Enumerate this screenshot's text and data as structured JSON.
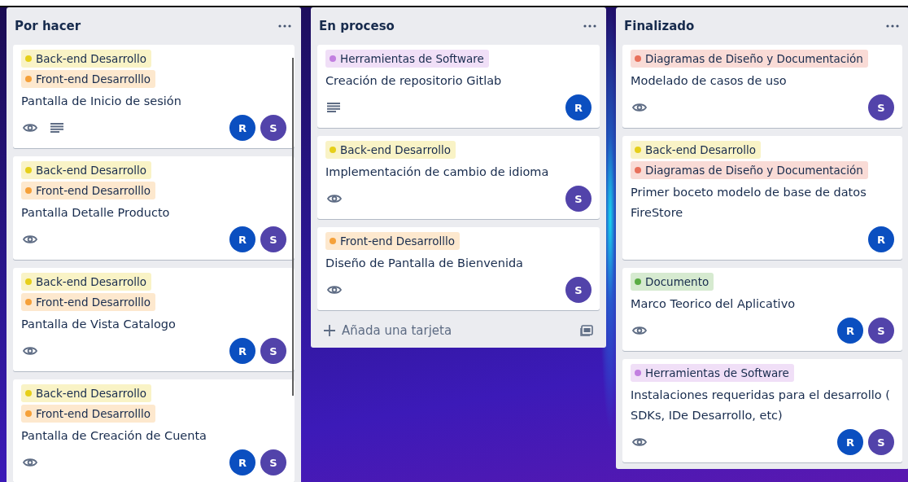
{
  "lists": [
    {
      "title": "Por hacer",
      "scrollbar": true,
      "cards": [
        {
          "labels": [
            {
              "text": "Back-end Desarrollo",
              "color": "#e6cf1a"
            },
            {
              "text": "Front-end Desarrolllo",
              "color": "#f5a13a"
            }
          ],
          "title": "Pantalla de Inicio de sesión",
          "watched": true,
          "has_description": true,
          "members": [
            {
              "initial": "R",
              "color": "#0b4fc0"
            },
            {
              "initial": "S",
              "color": "#5243aa"
            }
          ]
        },
        {
          "labels": [
            {
              "text": "Back-end Desarrollo",
              "color": "#e6cf1a"
            },
            {
              "text": "Front-end Desarrolllo",
              "color": "#f5a13a"
            }
          ],
          "title": "Pantalla Detalle Producto",
          "watched": true,
          "has_description": false,
          "members": [
            {
              "initial": "R",
              "color": "#0b4fc0"
            },
            {
              "initial": "S",
              "color": "#5243aa"
            }
          ]
        },
        {
          "labels": [
            {
              "text": "Back-end Desarrollo",
              "color": "#e6cf1a"
            },
            {
              "text": "Front-end Desarrolllo",
              "color": "#f5a13a"
            }
          ],
          "title": "Pantalla de Vista Catalogo",
          "watched": true,
          "has_description": false,
          "members": [
            {
              "initial": "R",
              "color": "#0b4fc0"
            },
            {
              "initial": "S",
              "color": "#5243aa"
            }
          ]
        },
        {
          "labels": [
            {
              "text": "Back-end Desarrollo",
              "color": "#e6cf1a"
            },
            {
              "text": "Front-end Desarrolllo",
              "color": "#f5a13a"
            }
          ],
          "title": "Pantalla de Creación de Cuenta",
          "watched": true,
          "has_description": false,
          "members": [
            {
              "initial": "R",
              "color": "#0b4fc0"
            },
            {
              "initial": "S",
              "color": "#5243aa"
            }
          ]
        }
      ]
    },
    {
      "title": "En proceso",
      "scrollbar": false,
      "add_card": {
        "label": "Añada una tarjeta"
      },
      "cards": [
        {
          "labels": [
            {
              "text": "Herramientas de Software",
              "color": "#c27fe0"
            }
          ],
          "title": "Creación de repositorio Gitlab",
          "watched": false,
          "has_description": true,
          "members": [
            {
              "initial": "R",
              "color": "#0b4fc0"
            }
          ]
        },
        {
          "labels": [
            {
              "text": "Back-end Desarrollo",
              "color": "#e6cf1a"
            }
          ],
          "title": "Implementación de cambio de idioma",
          "watched": true,
          "has_description": false,
          "members": [
            {
              "initial": "S",
              "color": "#5243aa"
            }
          ]
        },
        {
          "labels": [
            {
              "text": "Front-end Desarrolllo",
              "color": "#f5a13a"
            }
          ],
          "title": "Diseño de Pantalla de Bienvenida",
          "watched": true,
          "has_description": false,
          "members": [
            {
              "initial": "S",
              "color": "#5243aa"
            }
          ]
        }
      ]
    },
    {
      "title": "Finalizado",
      "scrollbar": false,
      "cards": [
        {
          "labels": [
            {
              "text": "Diagramas de Diseño y Documentación",
              "color": "#e8705c"
            }
          ],
          "title": "Modelado de casos de uso",
          "watched": true,
          "has_description": false,
          "members": [
            {
              "initial": "S",
              "color": "#5243aa"
            }
          ]
        },
        {
          "labels": [
            {
              "text": "Back-end Desarrollo",
              "color": "#e6cf1a"
            },
            {
              "text": "Diagramas de Diseño y Documentación",
              "color": "#e8705c"
            }
          ],
          "title": "Primer boceto modelo de base de datos FireStore",
          "watched": false,
          "has_description": false,
          "members": [
            {
              "initial": "R",
              "color": "#0b4fc0"
            }
          ]
        },
        {
          "labels": [
            {
              "text": "Documento",
              "color": "#5aac44"
            }
          ],
          "title": "Marco Teorico del Aplicativo",
          "watched": true,
          "has_description": false,
          "members": [
            {
              "initial": "R",
              "color": "#0b4fc0"
            },
            {
              "initial": "S",
              "color": "#5243aa"
            }
          ]
        },
        {
          "labels": [
            {
              "text": "Herramientas de Software",
              "color": "#c27fe0"
            }
          ],
          "title": "Instalaciones requeridas para el desarrollo ( SDKs, IDe Desarrollo, etc)",
          "watched": true,
          "has_description": false,
          "members": [
            {
              "initial": "R",
              "color": "#0b4fc0"
            },
            {
              "initial": "S",
              "color": "#5243aa"
            }
          ]
        }
      ]
    }
  ]
}
